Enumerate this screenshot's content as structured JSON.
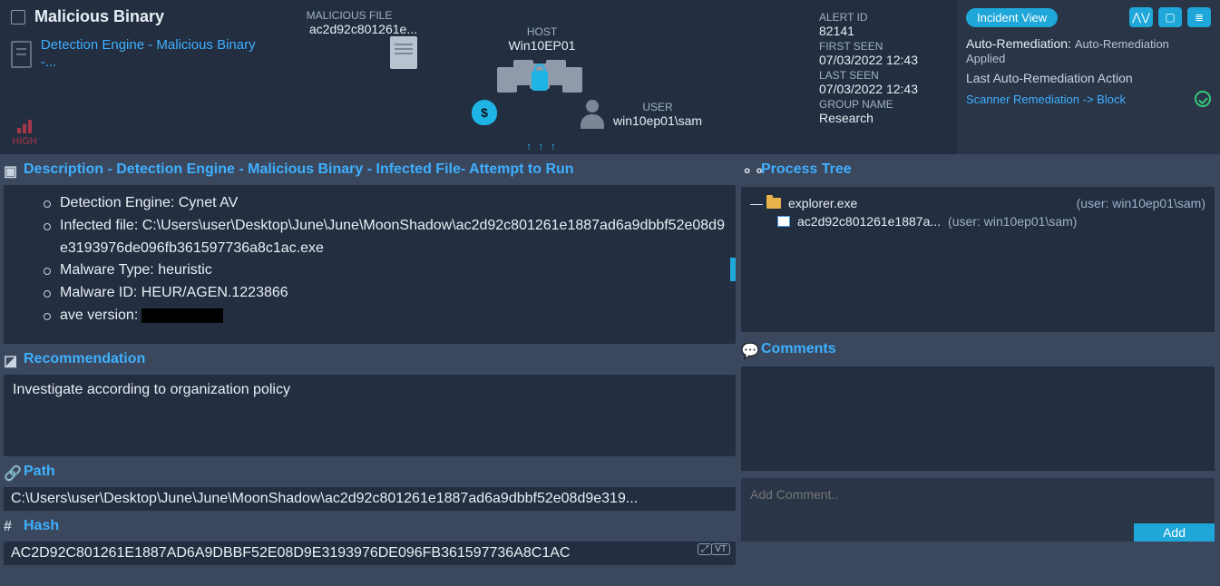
{
  "alert": {
    "title": "Malicious Binary",
    "detection_link": "Detection Engine - Malicious Binary -...",
    "severity": "HIGH"
  },
  "viz": {
    "file_label": "MALICIOUS FILE",
    "file_name": "ac2d92c801261e...",
    "host_label": "HOST",
    "host_name": "Win10EP01",
    "user_label": "USER",
    "user_name": "win10ep01\\sam",
    "arrows": "↑ ↑ ↑"
  },
  "meta": {
    "alert_id_label": "ALERT ID",
    "alert_id": "82141",
    "first_seen_label": "FIRST SEEN",
    "first_seen": "07/03/2022 12:43",
    "last_seen_label": "LAST SEEN",
    "last_seen": "07/03/2022 12:43",
    "group_label": "GROUP NAME",
    "group": "Research"
  },
  "panel": {
    "incident_view": "Incident View",
    "auto_rem_label": "Auto-Remediation:",
    "auto_rem_value": "Auto-Remediation Applied",
    "last_action_label": "Last Auto-Remediation Action",
    "last_action_link": "Scanner Remediation -> Block"
  },
  "description": {
    "header": "Description - Detection Engine - Malicious Binary - Infected File- Attempt to Run",
    "items": [
      "Detection Engine: Cynet AV",
      "Infected file: C:\\Users\\user\\Desktop\\June\\June\\MoonShadow\\ac2d92c801261e1887ad6a9dbbf52e08d9e3193976de096fb361597736a8c1ac.exe",
      "Malware Type: heuristic",
      "Malware ID: HEUR/AGEN.1223866",
      "ave version:"
    ]
  },
  "recommendation": {
    "header": "Recommendation",
    "text": "Investigate according to organization policy"
  },
  "path": {
    "header": "Path",
    "value": "C:\\Users\\user\\Desktop\\June\\June\\MoonShadow\\ac2d92c801261e1887ad6a9dbbf52e08d9e319..."
  },
  "hash": {
    "header": "Hash",
    "value": "AC2D92C801261E1887AD6A9DBBF52E08D9E3193976DE096FB361597736A8C1AC",
    "vt": "VT"
  },
  "process_tree": {
    "header": "Process Tree",
    "root": {
      "name": "explorer.exe",
      "user": "(user: win10ep01\\sam)"
    },
    "child": {
      "name": "ac2d92c801261e1887a...",
      "user": "(user: win10ep01\\sam)"
    }
  },
  "comments": {
    "header": "Comments",
    "placeholder": "Add Comment..",
    "add_label": "Add"
  }
}
